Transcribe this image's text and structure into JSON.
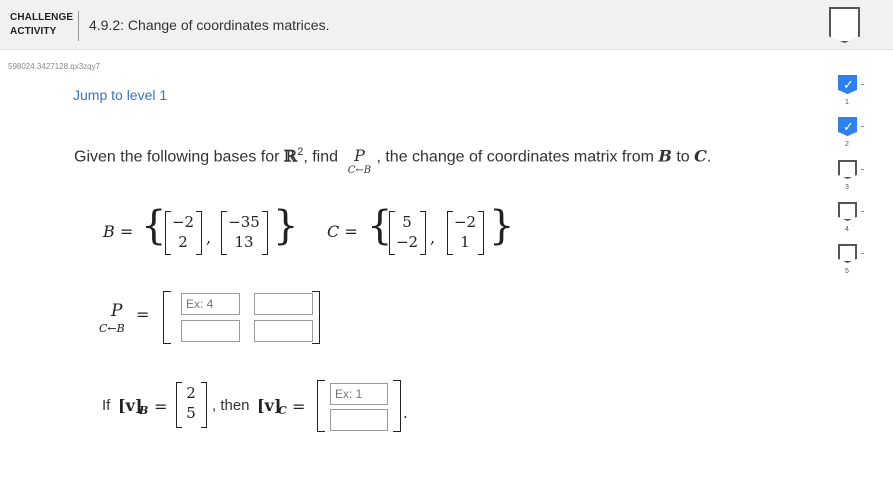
{
  "header": {
    "challenge_label": "CHALLENGE",
    "activity_label": "ACTIVITY",
    "title": "4.9.2: Change of coordinates matrices."
  },
  "activity_code": "598024.3427128.qx3zqy7",
  "jump_link": "Jump to level 1",
  "prompt": {
    "text1": "Given the following bases for ",
    "field": "ℝ",
    "field_exp": "2",
    "text2": ", find ",
    "p_symbol": "P",
    "p_sub": "C←B",
    "text3": ", the change of coordinates matrix from ",
    "basis_b": "B",
    "text4": " to ",
    "basis_c": "C",
    "text5": "."
  },
  "bases": {
    "b_label": "B =",
    "b_vectors": [
      [
        "−2",
        "2"
      ],
      [
        "−35",
        "13"
      ]
    ],
    "c_label": "C =",
    "c_vectors": [
      [
        "5",
        "−2"
      ],
      [
        "−2",
        "1"
      ]
    ]
  },
  "answer_matrix": {
    "p_symbol": "P",
    "p_sub": "C←B",
    "equals": "=",
    "inputs": [
      {
        "placeholder": "Ex: 4",
        "value": ""
      },
      {
        "placeholder": "",
        "value": ""
      },
      {
        "placeholder": "",
        "value": ""
      },
      {
        "placeholder": "",
        "value": ""
      }
    ]
  },
  "followup": {
    "if_text": "If",
    "vb_label": "[v]",
    "vb_sub": "B",
    "equals": "=",
    "vb_values": [
      "2",
      "5"
    ],
    "then_text": ", then",
    "vc_label": "[v]",
    "vc_sub": "C",
    "vc_inputs": [
      {
        "placeholder": "Ex: 1",
        "value": ""
      },
      {
        "placeholder": "",
        "value": ""
      }
    ],
    "period": "."
  },
  "levels": [
    {
      "number": "1",
      "completed": true
    },
    {
      "number": "2",
      "completed": true
    },
    {
      "number": "3",
      "completed": false
    },
    {
      "number": "4",
      "completed": false
    },
    {
      "number": "5",
      "completed": false
    }
  ],
  "colors": {
    "link": "#3a73b8",
    "completed": "#2f80ed",
    "header_bg": "#f1f1f1"
  },
  "icons": [
    "check-icon"
  ]
}
